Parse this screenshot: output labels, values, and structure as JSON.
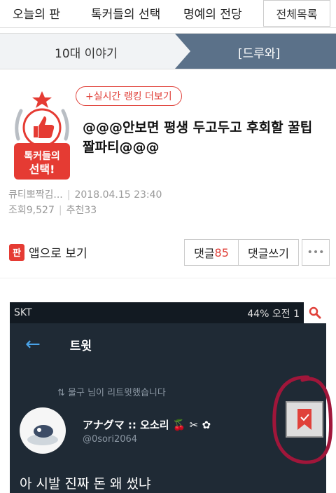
{
  "topnav": {
    "tabs": [
      "오늘의 판",
      "톡커들의 선택",
      "명예의 전당"
    ],
    "all_list": "전체목록"
  },
  "subnav": {
    "left": "10대 이야기",
    "right": "[드루와]"
  },
  "badge": {
    "line1": "톡커들의",
    "line2": "선택!"
  },
  "rank_button": "+실시간 랭킹 더보기",
  "post": {
    "title": "@@@안보면 평생 두고두고 후회할 꿀팁 짤파티@@@",
    "author": "큐티뽀짝김...",
    "datetime": "2018.04.15 23:40",
    "views_label": "조회",
    "views": "9,527",
    "likes_label": "추천",
    "likes": "33"
  },
  "actions": {
    "app_icon": "판",
    "app_view": "앱으로 보기",
    "comment_label": "댓글",
    "comment_count": "85",
    "write_comment": "댓글쓰기",
    "more": "•••"
  },
  "screenshot": {
    "carrier": "SKT",
    "status_right": "44% 오전 1",
    "header_title": "트윗",
    "retweet_text": "물구 님이 리트윗했습니다",
    "username": "アナグマ :: 오소리 🍒 ✂ ✿",
    "handle": "@0sori2064",
    "tweet_text": "아 시발 진짜 돈 왜 썼냐"
  },
  "colors": {
    "accent_red": "#e0413a",
    "subnav_active": "#5b7189",
    "tweet_bg": "#1f2a35",
    "annotation_circle": "#a0163a"
  }
}
